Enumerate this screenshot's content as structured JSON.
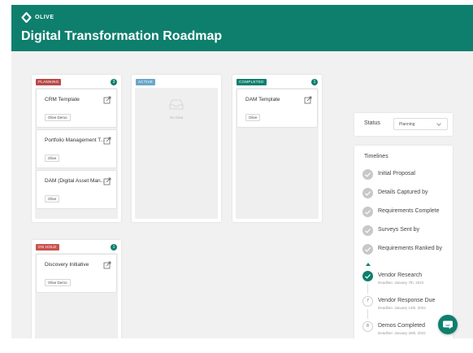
{
  "brand": {
    "logo_text": "OLIVE",
    "accent": "#0e7f6d"
  },
  "page": {
    "title": "Digital Transformation Roadmap"
  },
  "columns": {
    "planning": {
      "label": "PLANNING",
      "count": "3",
      "color": "#b94a48",
      "cards": [
        {
          "title": "CRM Template",
          "tag": "Olive Demo"
        },
        {
          "title": "Portfolio Management T...",
          "tag": "Olive"
        },
        {
          "title": "DAM (Digital Asset Man...",
          "tag": "Olive"
        }
      ]
    },
    "active": {
      "label": "ACTIVE",
      "color": "#6aa7c8",
      "empty_text": "No Data"
    },
    "completed": {
      "label": "COMPLETED",
      "count": "1",
      "color": "#0e7f6d",
      "cards": [
        {
          "title": "DAM Template",
          "tag": "Olive"
        }
      ]
    },
    "on_hold": {
      "label": "ON HOLD",
      "count": "1",
      "color": "#c9534f",
      "cards": [
        {
          "title": "Discovery Initiative",
          "tag": "Olive Demo"
        }
      ]
    }
  },
  "status_filter": {
    "label": "Status",
    "value": "Planning"
  },
  "timelines": {
    "title": "Timelines",
    "items": [
      {
        "label": "Initial Proposal",
        "state": "done"
      },
      {
        "label": "Details Captured by",
        "state": "done"
      },
      {
        "label": "Requirements Complete",
        "state": "done"
      },
      {
        "label": "Surveys Sent by",
        "state": "done"
      },
      {
        "label": "Requirements Ranked by",
        "state": "done"
      },
      {
        "label": "Vendor Research",
        "state": "current",
        "deadline": "Deadline: January 7th, 2022"
      },
      {
        "label": "Vendor Response Due",
        "state": "future",
        "number": "7",
        "deadline": "Deadline: January 14th, 2022"
      },
      {
        "label": "Demos Completed",
        "state": "future",
        "number": "8",
        "deadline": "Deadline: January 28th, 2022"
      }
    ]
  }
}
